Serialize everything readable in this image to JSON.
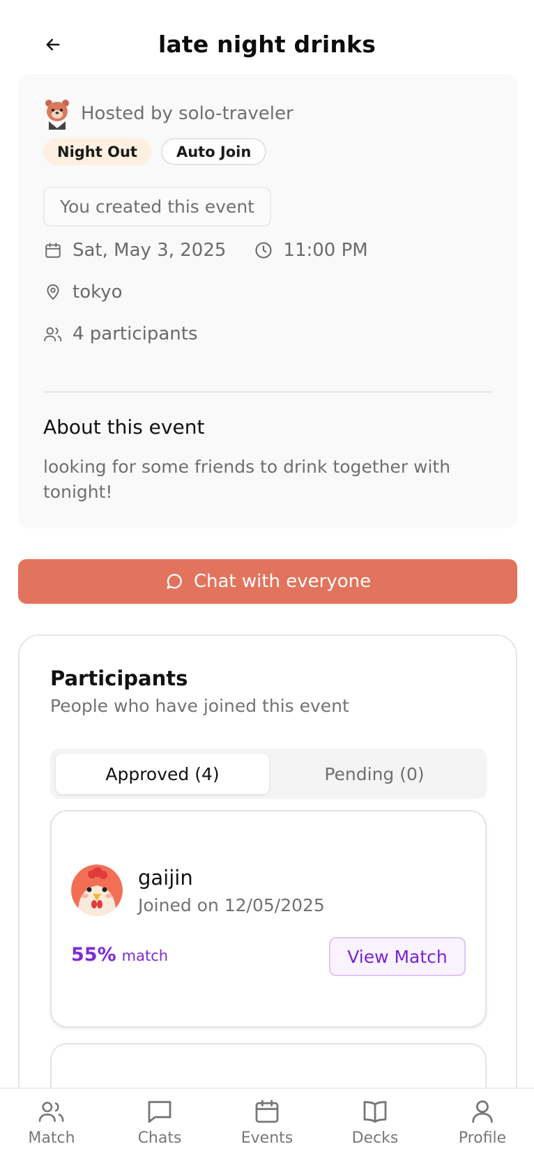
{
  "header": {
    "title": "late night drinks"
  },
  "host": {
    "text": "Hosted by solo-traveler"
  },
  "tags": [
    "Night Out",
    "Auto Join"
  ],
  "created_notice": "You created this event",
  "details": {
    "date": "Sat, May 3, 2025",
    "time": "11:00 PM",
    "location": "tokyo",
    "participants": "4 participants"
  },
  "about": {
    "title": "About this event",
    "text": "looking for some friends to drink together with tonight!"
  },
  "chat_button": "Chat with everyone",
  "participants_section": {
    "title": "Participants",
    "subtitle": "People who have joined this event",
    "tabs": [
      {
        "label": "Approved (4)",
        "active": true
      },
      {
        "label": "Pending (0)",
        "active": false
      }
    ],
    "people": [
      {
        "name": "gaijin",
        "joined": "Joined on 12/05/2025",
        "match_value": "55%",
        "match_label": "match",
        "action": "View Match"
      }
    ]
  },
  "nav": [
    {
      "label": "Match",
      "icon": "users-icon"
    },
    {
      "label": "Chats",
      "icon": "chat-icon"
    },
    {
      "label": "Events",
      "icon": "calendar-icon"
    },
    {
      "label": "Decks",
      "icon": "book-icon"
    },
    {
      "label": "Profile",
      "icon": "user-icon"
    }
  ],
  "colors": {
    "accent": "#e2735d",
    "match_purple": "#7e2ad6",
    "tag_night_bg": "#fdf0e1"
  }
}
